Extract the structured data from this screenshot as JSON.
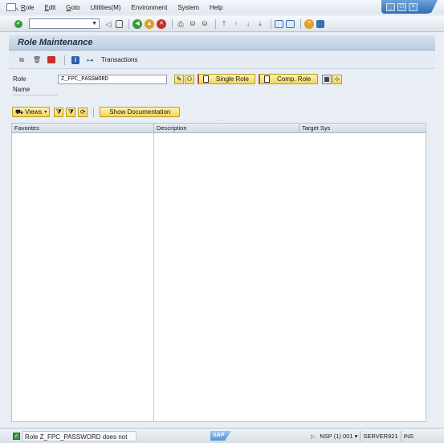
{
  "menu": {
    "items": [
      {
        "label": "Role",
        "underline": "R",
        "rest": "ole"
      },
      {
        "label": "Edit",
        "underline": "E",
        "rest": "dit"
      },
      {
        "label": "Goto",
        "underline": "G",
        "rest": "oto"
      },
      {
        "label": "Utilities(M)",
        "underline": "",
        "rest": "Utilities(M)"
      },
      {
        "label": "Environment",
        "underline": "",
        "rest": "Environment"
      },
      {
        "label": "System",
        "underline": "",
        "rest": "System"
      },
      {
        "label": "Help",
        "underline": "",
        "rest": "Help"
      }
    ]
  },
  "window_controls": {
    "minimize": "_",
    "maximize": "□",
    "close": "×"
  },
  "command_field": {
    "value": "",
    "dropdown_glyph": "▼"
  },
  "title": "Role Maintenance",
  "app_toolbar": {
    "transactions_label": "Transactions"
  },
  "form": {
    "role_label": "Role",
    "role_value": "Z_FPC_PASSWORD",
    "name_label": "Name",
    "single_role_button": "Single Role",
    "composite_role_button": "Comp. Role"
  },
  "tree_toolbar": {
    "views_button": "Views",
    "show_documentation_button": "Show Documentation"
  },
  "table": {
    "columns": [
      "Favorites",
      "Description",
      "Target Sys"
    ]
  },
  "status": {
    "message": "Role Z_FPC_PASSWORD does not exist",
    "logo": "SAP",
    "system": "NSP (1) 001",
    "server": "SERVER921",
    "mode": "INS"
  },
  "colors": {
    "accent_yellow": "#f3d55a",
    "title_blue": "#bccde0",
    "ok_green": "#3a9a3a"
  }
}
